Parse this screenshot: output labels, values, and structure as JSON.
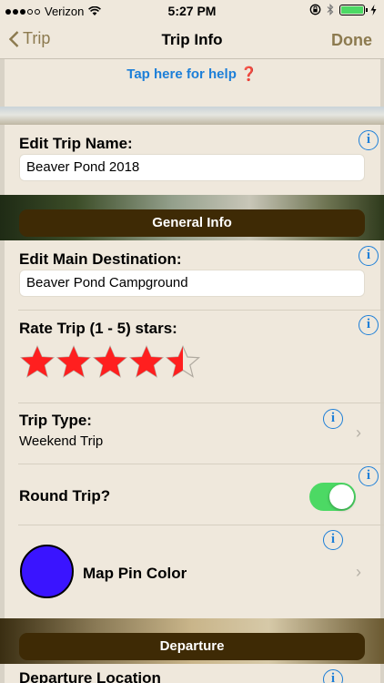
{
  "status_bar": {
    "carrier": "Verizon",
    "time": "5:27 PM"
  },
  "nav": {
    "back_label": "Trip",
    "title": "Trip Info",
    "done_label": "Done"
  },
  "help": {
    "text": "Tap here for help",
    "mark": "❓"
  },
  "trip_name": {
    "label": "Edit Trip Name:",
    "value": "Beaver Pond 2018"
  },
  "general_info": {
    "header": "General Info"
  },
  "destination": {
    "label": "Edit Main Destination:",
    "value": "Beaver Pond Campground"
  },
  "rating": {
    "label": "Rate Trip (1 - 5) stars:",
    "value": 4.5,
    "max": 5,
    "star_color": "#ff1f1f"
  },
  "trip_type": {
    "label": "Trip Type:",
    "value": "Weekend Trip"
  },
  "round_trip": {
    "label": "Round Trip?",
    "enabled": true,
    "toggle_color": "#4cd964"
  },
  "map_pin": {
    "label": "Map Pin Color",
    "color": "#3a14ff"
  },
  "departure": {
    "header": "Departure",
    "label": "Departure Location"
  },
  "info_symbol": "i",
  "chevron": "›",
  "accent_color": "#8c7a4f",
  "link_color": "#1d7fd8"
}
